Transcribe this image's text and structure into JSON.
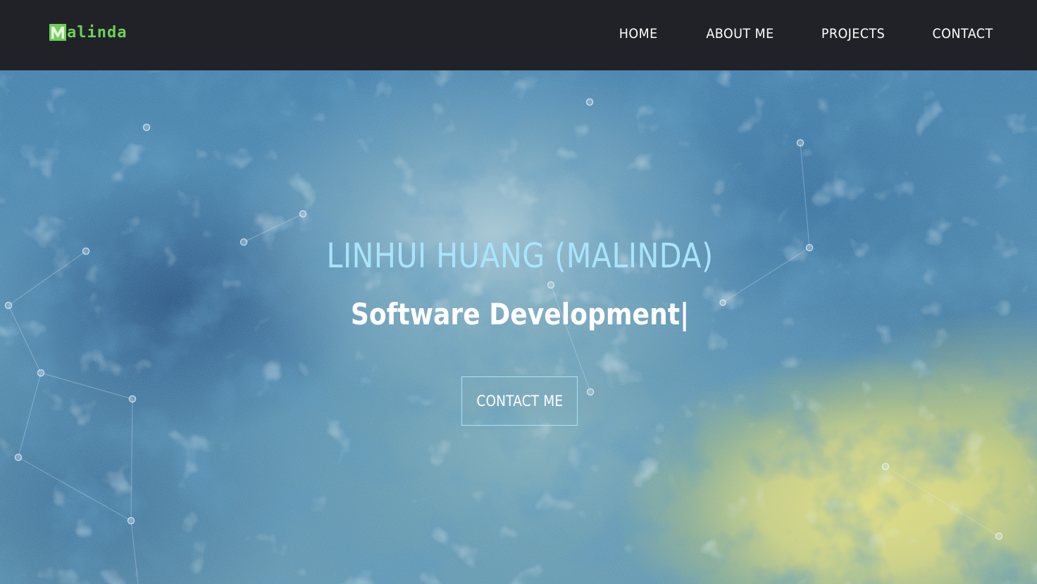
{
  "navbar": {
    "logo": {
      "mark_letter": "M",
      "text": "alinda",
      "color": "#6fcf59"
    },
    "links": [
      {
        "label": "HOME"
      },
      {
        "label": "ABOUT ME"
      },
      {
        "label": "PROJECTS"
      },
      {
        "label": "CONTACT"
      }
    ],
    "background": "#202227"
  },
  "hero": {
    "title": "LINHUI HUANG (MALINDA)",
    "subtitle": "Software Development|",
    "cta_label": "CONTACT ME",
    "title_color": "#a9e4fb",
    "background_style": "watercolor blue and yellow with particle network"
  }
}
